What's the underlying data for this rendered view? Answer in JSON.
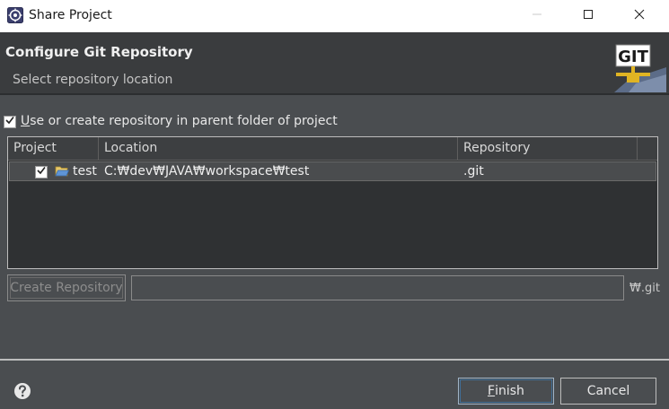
{
  "window": {
    "title": "Share Project",
    "controls": [
      "minimize-icon",
      "maximize-icon",
      "close-icon"
    ]
  },
  "header": {
    "title": "Configure Git Repository",
    "subtitle": "Select repository location",
    "icon": "git-repository-icon",
    "icon_text": "GIT"
  },
  "use_parent_repo": {
    "checked": true,
    "mnemonic": "U",
    "label_rest": "se or create repository in parent folder of project"
  },
  "table": {
    "columns": [
      "Project",
      "Location",
      "Repository"
    ],
    "rows": [
      {
        "checked": true,
        "project": "test",
        "location": "C:₩dev₩JAVA₩workspace₩test",
        "repository": ".git"
      }
    ]
  },
  "create_repo": {
    "button_label": "Create Repository",
    "input_value": "",
    "suffix": "₩.git"
  },
  "footer": {
    "finish_mnemonic": "F",
    "finish_rest": "inish",
    "cancel_label": "Cancel"
  },
  "colors": {
    "background": "#4a4d50",
    "header_bg": "#3a3c3e",
    "table_bg": "#2f3133",
    "focus_border": "#3f6f99"
  }
}
